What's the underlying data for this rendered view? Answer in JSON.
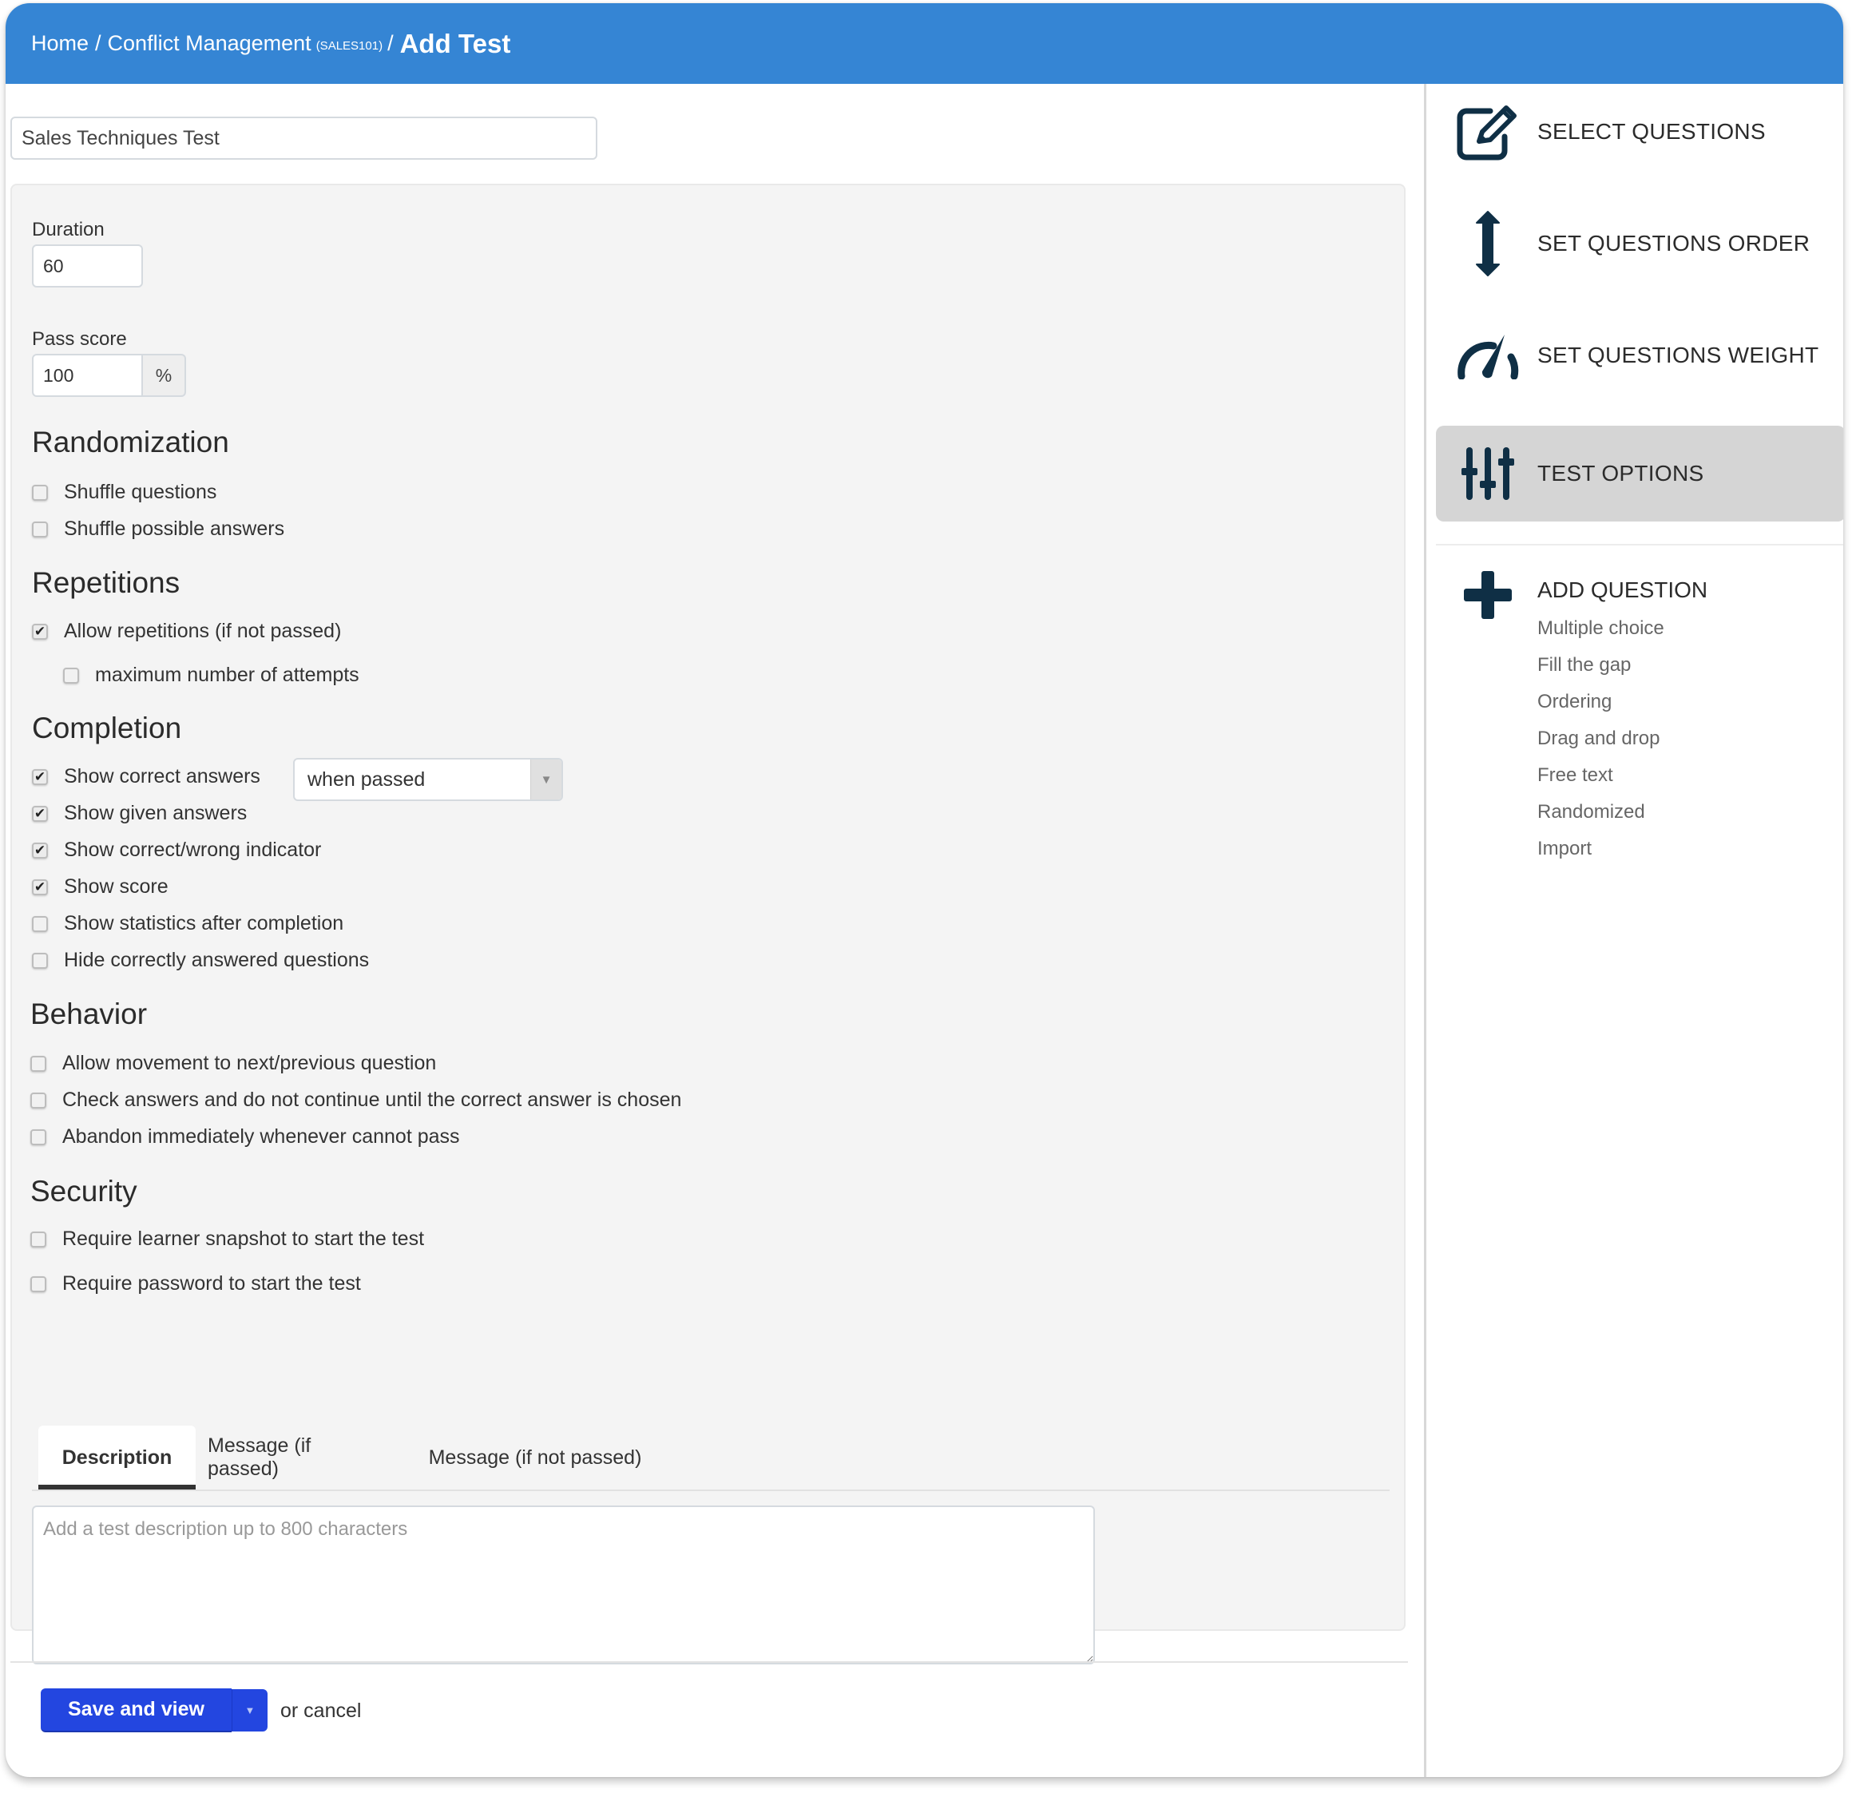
{
  "header": {
    "breadcrumb_home": "Home",
    "separator": "/",
    "course_name": "Conflict Management",
    "course_code": "(SALES101)",
    "current_page": "Add Test",
    "color": "#3585d4"
  },
  "form": {
    "test_title_value": "Sales Techniques Test",
    "duration": {
      "label": "Duration",
      "value": "60"
    },
    "pass_score": {
      "label": "Pass score",
      "value": "100",
      "unit": "%"
    },
    "sections": {
      "randomization": {
        "title": "Randomization",
        "options": [
          {
            "label": "Shuffle questions",
            "checked": false
          },
          {
            "label": "Shuffle possible answers",
            "checked": false
          }
        ]
      },
      "repetitions": {
        "title": "Repetitions",
        "options": [
          {
            "label": "Allow repetitions (if not passed)",
            "checked": true
          },
          {
            "label": "maximum number of attempts",
            "checked": false
          }
        ]
      },
      "completion": {
        "title": "Completion",
        "show_correct_select": {
          "selected": "when passed"
        },
        "options": [
          {
            "label": "Show correct answers",
            "checked": true
          },
          {
            "label": "Show given answers",
            "checked": true
          },
          {
            "label": "Show correct/wrong indicator",
            "checked": true
          },
          {
            "label": "Show score",
            "checked": true
          },
          {
            "label": "Show statistics after completion",
            "checked": false
          },
          {
            "label": "Hide correctly answered questions",
            "checked": false
          }
        ]
      },
      "behavior": {
        "title": "Behavior",
        "options": [
          {
            "label": "Allow movement to next/previous question",
            "checked": false
          },
          {
            "label": "Check answers and do not continue until the correct answer is chosen",
            "checked": false
          },
          {
            "label": "Abandon immediately whenever cannot pass",
            "checked": false
          }
        ]
      },
      "security": {
        "title": "Security",
        "options": [
          {
            "label": "Require learner snapshot to start the test",
            "checked": false
          },
          {
            "label": "Require password to start the test",
            "checked": false
          }
        ]
      }
    },
    "tabs": [
      {
        "label": "Description",
        "active": true
      },
      {
        "label": "Message (if passed)",
        "active": false
      },
      {
        "label": "Message (if not passed)",
        "active": false
      }
    ],
    "description_placeholder": "Add a test description up to 800 characters",
    "description_value": ""
  },
  "footer": {
    "save_label": "Save and view",
    "caret": "▼",
    "cancel_text": "or cancel",
    "save_color": "#2346e0"
  },
  "sidebar": {
    "items": [
      {
        "label": "SELECT QUESTIONS",
        "icon": "edit-icon",
        "active": false
      },
      {
        "label": "SET QUESTIONS ORDER",
        "icon": "vertical-arrows-icon",
        "active": false
      },
      {
        "label": "SET QUESTIONS WEIGHT",
        "icon": "gauge-icon",
        "active": false
      },
      {
        "label": "TEST OPTIONS",
        "icon": "sliders-icon",
        "active": true
      }
    ],
    "add_question": {
      "label": "ADD QUESTION",
      "icon": "plus-icon",
      "types": [
        "Multiple choice",
        "Fill the gap",
        "Ordering",
        "Drag and drop",
        "Free text",
        "Randomized",
        "Import"
      ]
    }
  }
}
